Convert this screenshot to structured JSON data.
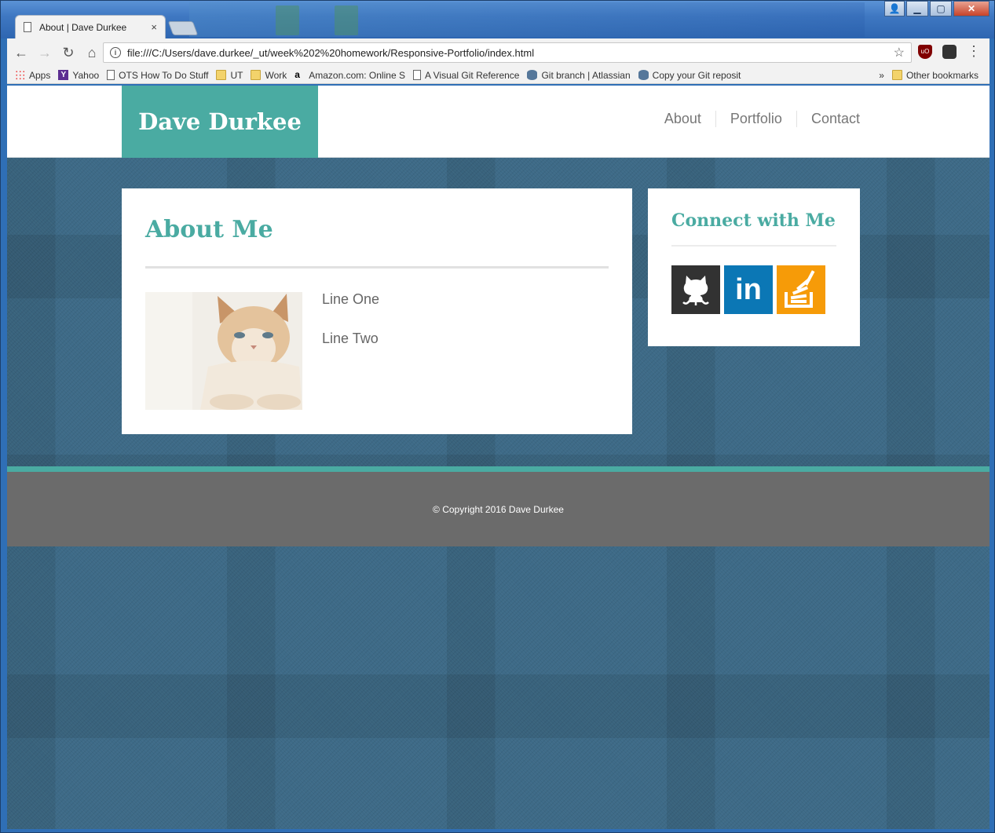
{
  "browser": {
    "tab_title": "About | Dave Durkee",
    "tab_close": "×",
    "url": "file:///C:/Users/dave.durkee/_ut/week%202%20homework/Responsive-Portfolio/index.html",
    "info_icon": "i",
    "star_icon": "☆",
    "menu_icon": "⋮",
    "ublock_label": "uO",
    "back": "←",
    "forward": "→",
    "reload": "↻",
    "home": "⌂",
    "window_controls": {
      "user": "👤",
      "minimize": "▁",
      "maximize": "▢",
      "close": "✕"
    }
  },
  "bookmarks": {
    "items": [
      {
        "label": "Apps",
        "icon": "apps-icon"
      },
      {
        "label": "Yahoo",
        "icon": "yahoo-icon"
      },
      {
        "label": "OTS How To Do Stuff",
        "icon": "page-icon"
      },
      {
        "label": "UT",
        "icon": "folder-icon"
      },
      {
        "label": "Work",
        "icon": "folder-icon"
      },
      {
        "label": "Amazon.com: Online S",
        "icon": "amazon-icon"
      },
      {
        "label": "A Visual Git Reference",
        "icon": "page-icon"
      },
      {
        "label": "Git branch | Atlassian",
        "icon": "database-icon"
      },
      {
        "label": "Copy your Git reposit",
        "icon": "database-icon"
      }
    ],
    "more": "»",
    "other": "Other bookmarks"
  },
  "site": {
    "brand": "Dave Durkee",
    "nav": [
      "About",
      "Portfolio",
      "Contact"
    ],
    "main": {
      "heading": "About Me",
      "line_one": "Line One",
      "line_two": "Line Two"
    },
    "sidebar": {
      "heading": "Connect with Me",
      "linkedin_label": "in"
    },
    "footer": "© Copyright 2016 Dave Durkee",
    "colors": {
      "accent": "#4aaba2",
      "footer": "#6b6b6b",
      "github": "#323232",
      "linkedin": "#0b77b5",
      "stackoverflow": "#f69b08"
    }
  }
}
